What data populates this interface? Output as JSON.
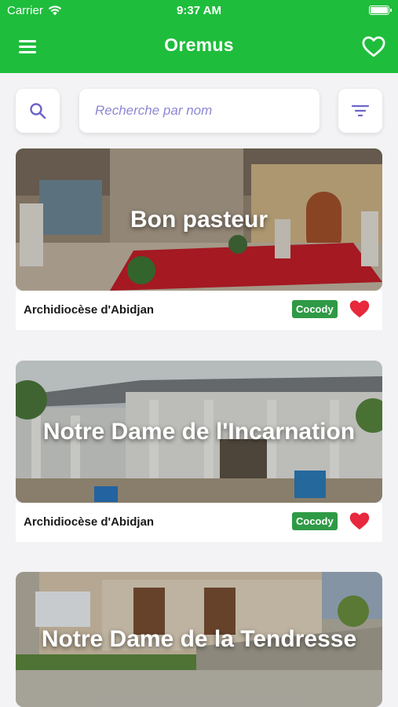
{
  "status_bar": {
    "carrier": "Carrier",
    "time": "9:37 AM"
  },
  "app_bar": {
    "title": "Oremus",
    "icons": [
      "menu-icon",
      "heart-outline-icon"
    ]
  },
  "search": {
    "placeholder": "Recherche par nom",
    "value": "",
    "icons": [
      "search-icon",
      "filter-icon"
    ]
  },
  "colors": {
    "primary": "#1fbd3c",
    "tag": "#2f9a45",
    "favorite": "#e8283c",
    "placeholder": "#8d87d3"
  },
  "parishes": [
    {
      "name": "Bon pasteur",
      "diocese": "Archidiocèse d'Abidjan",
      "commune": "Cocody",
      "favorite": true
    },
    {
      "name": "Notre Dame de l'Incarnation",
      "diocese": "Archidiocèse d'Abidjan",
      "commune": "Cocody",
      "favorite": true
    },
    {
      "name": "Notre Dame de la Tendresse",
      "diocese": "",
      "commune": "",
      "favorite": false
    }
  ]
}
